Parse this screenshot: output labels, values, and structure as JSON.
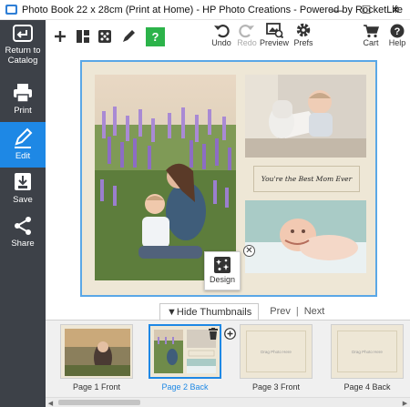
{
  "window": {
    "title": "Photo Book 22 x 28cm (Print at Home) - HP Photo Creations - Powered by RocketLife",
    "minimize": "—",
    "maximize": "☐",
    "close": "✕"
  },
  "sidebar": {
    "items": [
      {
        "label": "Return to Catalog",
        "icon": "return-icon"
      },
      {
        "label": "Print",
        "icon": "printer-icon"
      },
      {
        "label": "Edit",
        "icon": "pencil-icon"
      },
      {
        "label": "Save",
        "icon": "save-icon"
      },
      {
        "label": "Share",
        "icon": "share-icon"
      }
    ],
    "active": "Edit"
  },
  "toolbar": {
    "undo": "Undo",
    "redo": "Redo",
    "preview": "Preview",
    "prefs": "Prefs",
    "cart": "Cart",
    "help": "Help",
    "help_badge": "?"
  },
  "page": {
    "caption": "You're the Best Mom Ever",
    "design_label": "Design",
    "close_glyph": "✕"
  },
  "thumbnails": {
    "hide_label": "▼Hide Thumbnails",
    "prev": "Prev",
    "separator": "|",
    "next": "Next",
    "items": [
      {
        "label": "Page 1 Front",
        "placeholder": ""
      },
      {
        "label": "Page 2 Back",
        "placeholder": ""
      },
      {
        "label": "Page 3 Front",
        "placeholder": "Drag Photo Here"
      },
      {
        "label": "Page 4 Back",
        "placeholder": "Drag Photo Here"
      }
    ],
    "selected": "Page 2 Back"
  },
  "colors": {
    "sidebar": "#3d4148",
    "accent": "#1e88e5",
    "help_green": "#2cb34a",
    "page_background": "#eee7d6"
  }
}
